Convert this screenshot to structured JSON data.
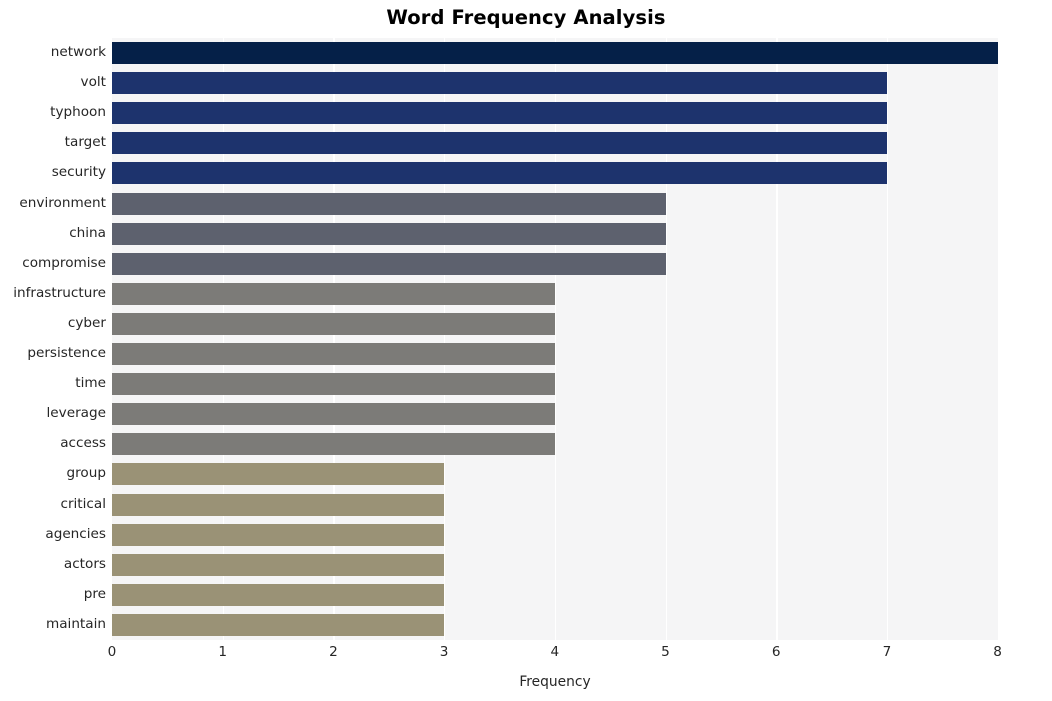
{
  "chart_data": {
    "type": "bar",
    "orientation": "horizontal",
    "title": "Word Frequency Analysis",
    "xlabel": "Frequency",
    "ylabel": "",
    "xlim": [
      0,
      8.2
    ],
    "xticks": [
      "0",
      "1",
      "2",
      "3",
      "4",
      "5",
      "6",
      "7",
      "8"
    ],
    "xtick_values": [
      0,
      1,
      2,
      3,
      4,
      5,
      6,
      7,
      8
    ],
    "grid": "vertical-only",
    "legend": "none",
    "categories": [
      "network",
      "volt",
      "typhoon",
      "target",
      "security",
      "environment",
      "china",
      "compromise",
      "infrastructure",
      "cyber",
      "persistence",
      "time",
      "leverage",
      "access",
      "group",
      "critical",
      "agencies",
      "actors",
      "pre",
      "maintain"
    ],
    "values": [
      8,
      7,
      7,
      7,
      7,
      5,
      5,
      5,
      4,
      4,
      4,
      4,
      4,
      4,
      3,
      3,
      3,
      3,
      3,
      3
    ],
    "bar_colors": [
      "#052048",
      "#1d336d",
      "#1d336d",
      "#1d336d",
      "#1d336d",
      "#5d616e",
      "#5d616e",
      "#5d616e",
      "#7c7b78",
      "#7c7b78",
      "#7c7b78",
      "#7c7b78",
      "#7c7b78",
      "#7c7b78",
      "#9a9276",
      "#9a9276",
      "#9a9276",
      "#9a9276",
      "#9a9276",
      "#9a9276"
    ]
  },
  "style": {
    "plot_background": "#f5f5f6",
    "figure_background": "#ffffff",
    "gridline_color": "#ffffff",
    "text_color": "#262626",
    "title_color": "#000000"
  }
}
